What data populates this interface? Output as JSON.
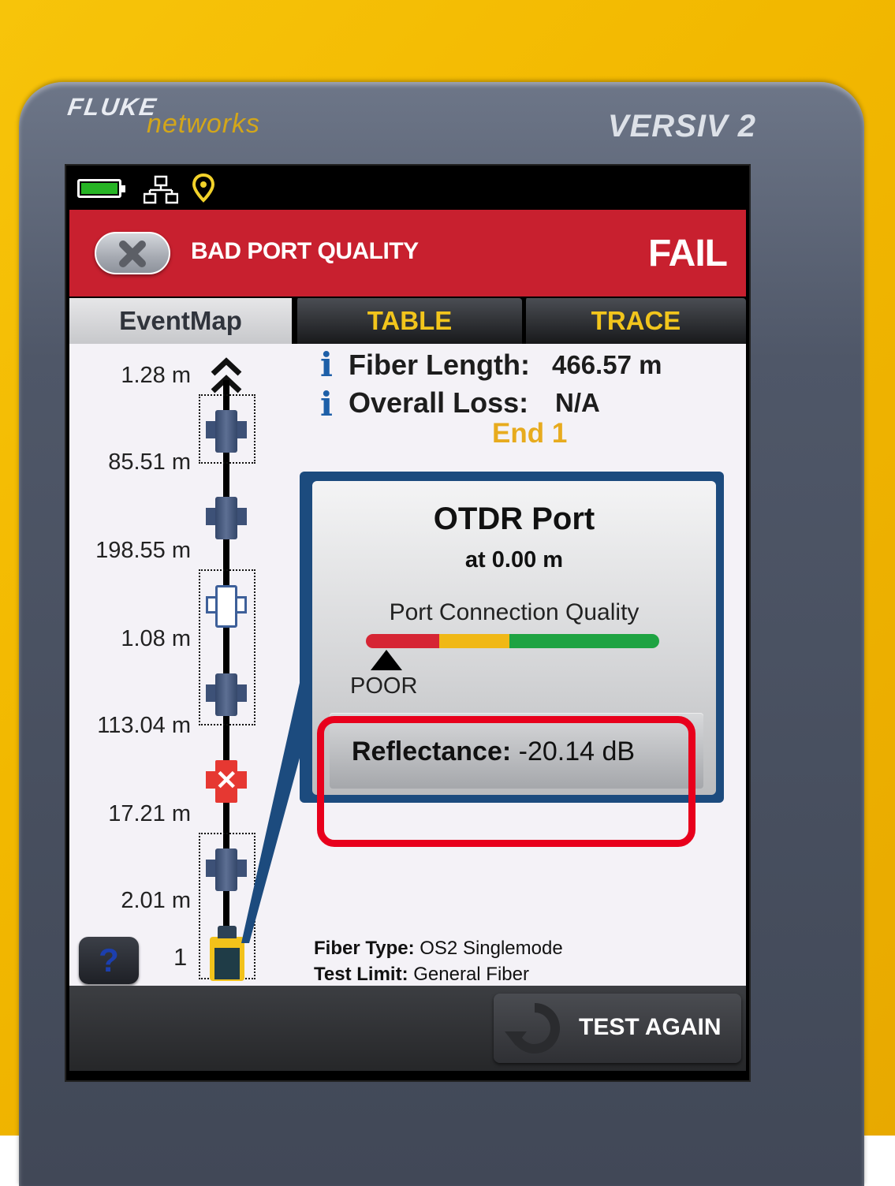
{
  "device": {
    "brand_line1": "FLUKE",
    "brand_line2": "networks",
    "model": "VERSIV 2"
  },
  "status_bar": {
    "icons": [
      "battery-icon",
      "network-icon",
      "location-pin-icon"
    ]
  },
  "header": {
    "title": "BAD PORT QUALITY",
    "result": "FAIL",
    "close_icon": "close-icon",
    "color": "#c8202f"
  },
  "tabs": [
    {
      "label": "EventMap",
      "active": true
    },
    {
      "label": "TABLE",
      "active": false
    },
    {
      "label": "TRACE",
      "active": false
    }
  ],
  "summary": {
    "fiber_length_label": "Fiber Length:",
    "fiber_length_value": "466.57 m",
    "overall_loss_label": "Overall Loss:",
    "overall_loss_value": "N/A",
    "end_label": "End 1"
  },
  "event_map": {
    "distances": [
      "1.28 m",
      "85.51 m",
      "198.55 m",
      "1.08 m",
      "113.04 m",
      "17.21 m",
      "2.01 m"
    ],
    "end_number": "1",
    "help_label": "?"
  },
  "popup": {
    "title": "OTDR Port",
    "subtitle": "at 0.00 m",
    "quality_label": "Port Connection Quality",
    "quality_rating": "POOR",
    "reflectance_label": "Reflectance:",
    "reflectance_value": "-20.14 dB"
  },
  "fiber_info": {
    "type_label": "Fiber Type:",
    "type_value": "OS2 Singlemode",
    "limit_label": "Test Limit:",
    "limit_value": "General Fiber"
  },
  "footer": {
    "test_again_label": "TEST AGAIN"
  },
  "colors": {
    "fail_red": "#c8202f",
    "accent_yellow": "#f2c51c",
    "highlight": "#e8001c"
  }
}
